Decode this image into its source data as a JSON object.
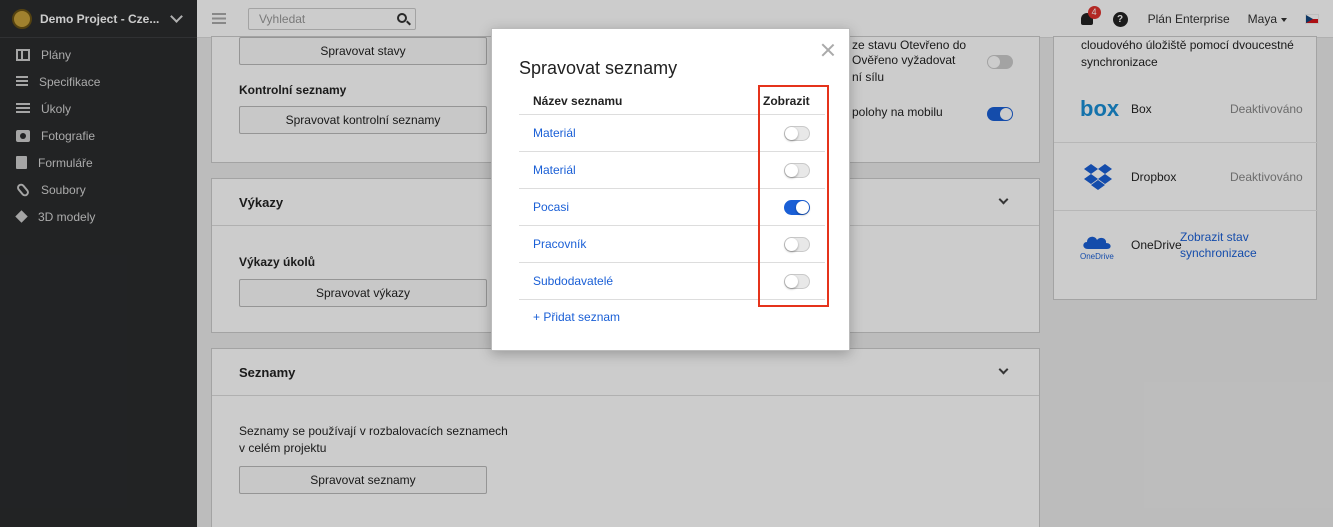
{
  "project": {
    "name": "Demo Project - Cze..."
  },
  "sidebar": {
    "items": [
      {
        "label": "Plány",
        "icon": "plans-icon"
      },
      {
        "label": "Specifikace",
        "icon": "specifications-icon"
      },
      {
        "label": "Úkoly",
        "icon": "tasks-icon"
      },
      {
        "label": "Fotografie",
        "icon": "camera-icon"
      },
      {
        "label": "Formuláře",
        "icon": "clipboard-icon"
      },
      {
        "label": "Soubory",
        "icon": "paperclip-icon"
      },
      {
        "label": "3D modely",
        "icon": "cube-icon"
      }
    ]
  },
  "topbar": {
    "search_placeholder": "Vyhledat",
    "notifications_count": "4",
    "help": "?",
    "plan": "Plán Enterprise",
    "user": "Maya"
  },
  "bg": {
    "manage_states": "Spravovat stavy",
    "checklists_label": "Kontrolní seznamy",
    "manage_checklists": "Spravovat kontrolní seznamy",
    "reports_title": "Výkazy",
    "task_reports_label": "Výkazy úkolů",
    "manage_reports": "Spravovat výkazy",
    "lists_title": "Seznamy",
    "lists_desc_1": "Seznamy se používají v rozbalovacích seznamech",
    "lists_desc_2": "v celém projektu",
    "manage_lists": "Spravovat seznamy",
    "setting_text_1": "ze stavu Otevřeno do",
    "setting_text_2": "Ověřeno vyžadovat",
    "setting_text_3": "ní sílu",
    "setting_text_4": "polohy na mobilu"
  },
  "sync": {
    "desc_1": "cloudového úložiště pomocí dvoucestné",
    "desc_2": "synchronizace",
    "box": {
      "logo": "box",
      "name": "Box",
      "status": "Deaktivováno"
    },
    "dropbox": {
      "name": "Dropbox",
      "status": "Deaktivováno"
    },
    "onedrive": {
      "logo": "OneDrive",
      "name": "OneDrive",
      "link_1": "Zobrazit stav",
      "link_2": "synchronizace"
    }
  },
  "modal": {
    "title": "Spravovat seznamy",
    "col_name": "Název seznamu",
    "col_show": "Zobrazit",
    "rows": [
      {
        "name": "Materiál",
        "on": false
      },
      {
        "name": "Materiál",
        "on": false
      },
      {
        "name": "Pocasi",
        "on": true
      },
      {
        "name": "Pracovník",
        "on": false
      },
      {
        "name": "Subdodavatelé",
        "on": false
      }
    ],
    "add_list": "+ Přidat seznam"
  },
  "colors": {
    "accent": "#1a5fd6",
    "highlight": "#e5331b",
    "sidebar": "#2b2c2e"
  }
}
